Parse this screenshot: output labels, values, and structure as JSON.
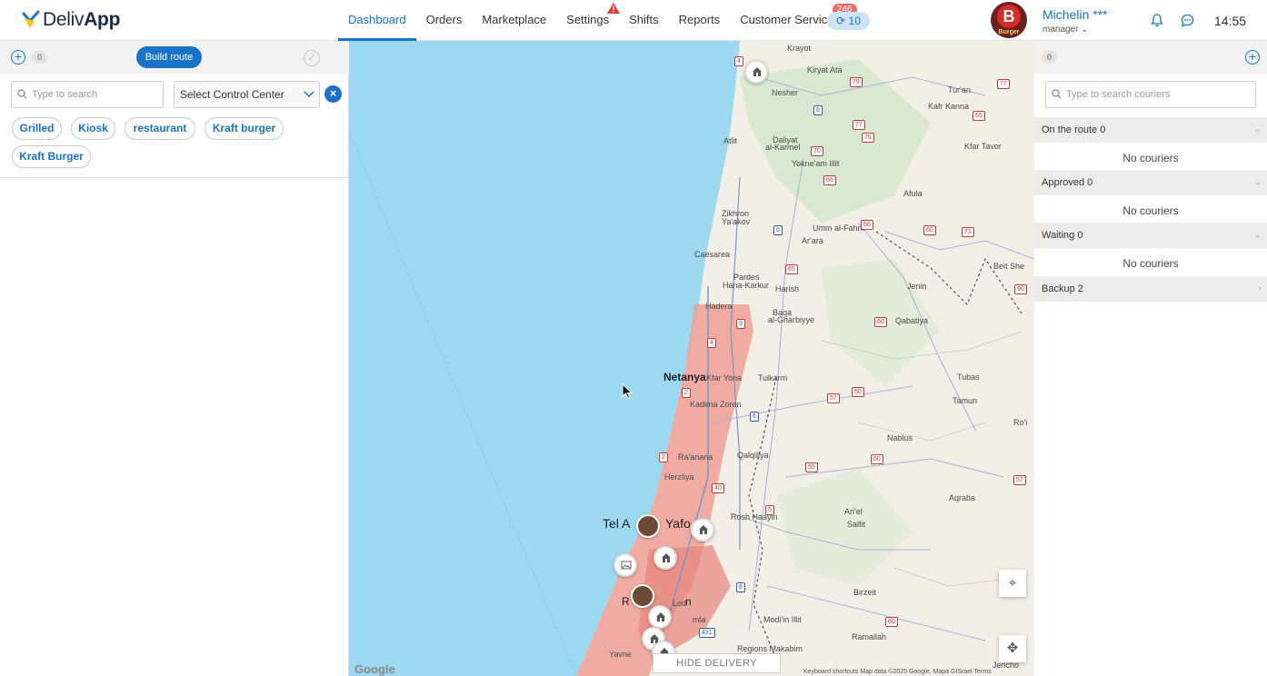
{
  "app": {
    "logo_prefix": "Deliv",
    "logo_suffix": "App"
  },
  "nav": {
    "items": [
      {
        "label": "Dashboard",
        "active": true
      },
      {
        "label": "Orders"
      },
      {
        "label": "Marketplace"
      },
      {
        "label": "Settings"
      },
      {
        "label": "Shifts"
      },
      {
        "label": "Reports"
      },
      {
        "label": "Customer Service"
      }
    ],
    "settings_warning_icon": "warning-triangle-icon",
    "customer_service_badge": "246",
    "refresh_pill": "10"
  },
  "user": {
    "name": "Michelin ***",
    "role": "manager",
    "avatar_letter": "B",
    "avatar_brand": "Burger"
  },
  "header_time": "14:55",
  "left_panel": {
    "orders_count": "0",
    "build_route_label": "Build route",
    "search_placeholder": "Type to search",
    "control_center_label": "Select Control Center",
    "tags": [
      "Grilled",
      "Kiosk",
      "restaurant",
      "Kraft burger",
      "Kraft Burger"
    ]
  },
  "map": {
    "hide_regions_label": "HIDE DELIVERY REGIONS",
    "google_label": "Google",
    "attribution": "Keyboard shortcuts   Map data ©2025 Google, Mapa GISrael   Terms",
    "labels": {
      "krayot": "Krayot",
      "kiryat_ata": "Kiryat Ata",
      "nesher": "Nesher",
      "tur_an": "Tur'an",
      "kafr_kanna": "Kafr Kanna",
      "daliyat": "Daliyat",
      "al_karmel": "al-Karmel",
      "yokne": "Yokne'am Illit",
      "kfar_tavor": "Kfar Tavor",
      "atlit": "Atlit",
      "afula": "Afula",
      "zikhron": "Zikhron",
      "yaakov": "Ya'akov",
      "caesarea": "Caesarea",
      "umm": "Umm al-Fahm",
      "ar_ara": "Ar'ara",
      "pardes": "Pardes",
      "hana": "Hana-Karkur",
      "harish": "Harish",
      "beit_she": "Beit She",
      "jenin": "Jenin",
      "hadera": "Hadera",
      "baqa": "Baqa",
      "gharbiyye": "al-Gharbiyye",
      "qabatiya": "Qabatiya",
      "netanya": "Netanya",
      "kfar_yona": "Kfar Yona",
      "tulkarm": "Tulkarm",
      "tubas": "Tubas",
      "kadima": "Kadima Zoran",
      "tamun": "Tamun",
      "roi": "Ro'i",
      "nablus": "Nablus",
      "qalqiliya": "Qalqiliya",
      "raanana": "Ra'anana",
      "herzliya": "Herzliya",
      "aqraba": "Aqraba",
      "tel_aviv": "Tel A",
      "yafo": "Yafo",
      "rosh": "Rosh Haayin",
      "ariel": "Ari'el",
      "salfit": "Salfit",
      "birzeit": "Birzeit",
      "lod": "Lod",
      "ramla": "mla",
      "modiin": "Modi'in Illit",
      "ramallah": "Ramallah",
      "makabim": "Regions Makabim",
      "yavne": "Yavne",
      "jericho": "Jericho",
      "r": "R",
      "n": "n"
    }
  },
  "right_panel": {
    "couriers_count": "0",
    "search_placeholder": "Type to search couriers",
    "groups": [
      {
        "label": "On the route 0",
        "empty": "No couriers"
      },
      {
        "label": "Approved 0",
        "empty": "No couriers"
      },
      {
        "label": "Waiting 0",
        "empty": "No couriers"
      },
      {
        "label": "Backup 2"
      }
    ]
  },
  "colors": {
    "accent": "#1a73c8",
    "badge": "#f36b6b",
    "region_fill": "#f0a096",
    "sea": "#9cd9f0",
    "land": "#f2efe6"
  }
}
